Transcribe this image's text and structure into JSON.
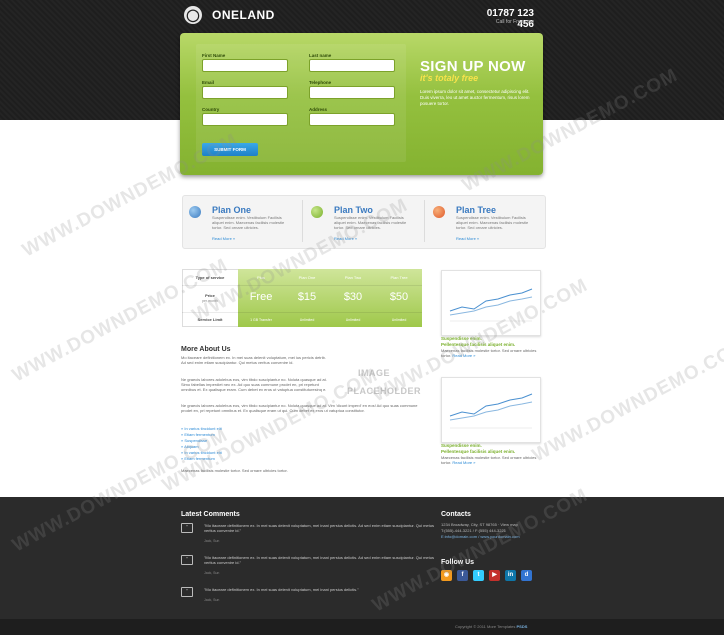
{
  "header": {
    "logo_glyph": "◯",
    "brand": "ONELAND",
    "phone": "01787 123 456",
    "phone_note": "Call for Free now"
  },
  "signup": {
    "fields": [
      {
        "label": "First Name"
      },
      {
        "label": "Last name"
      },
      {
        "label": "Email"
      },
      {
        "label": "Telephone"
      },
      {
        "label": "Country"
      },
      {
        "label": "Address"
      }
    ],
    "submit_label": "SUBMIT FORM",
    "title": "SIGN UP NOW",
    "subtitle": "it's totaly free",
    "body": "Lorem ipsum dolor sit amet, consectetur adipiscing elit. Duis viverra, leo ut amet auctor fermentum, risus lorem posuere tortor."
  },
  "plans": [
    {
      "title": "Plan One",
      "text": "Suspendisse enim. Vestibulum Facilisis aliquet enim. Maecenas facilisis molestie tortor. Sed ornare ultricies.",
      "link": "Read More »",
      "color": "#3a7ac0"
    },
    {
      "title": "Plan Two",
      "text": "Suspendisse enim. Vestibulum Facilisis aliquet enim. Maecenas facilisis molestie tortor. Sed ornare ultricies.",
      "link": "Read More »",
      "color": "#7ab02c"
    },
    {
      "title": "Plan Tree",
      "text": "Suspendisse enim. Vestibulum Facilisis aliquet enim. Maecenas facilisis molestie tortor. Sed ornare ultricies.",
      "link": "Read More »",
      "color": "#e0592a"
    }
  ],
  "pricing": {
    "row_labels": {
      "type": "Type of service",
      "price": "Price",
      "price_sub": "per month",
      "limit": "Service Limit"
    },
    "columns": [
      {
        "header": "Plus",
        "price": "Free",
        "limit": "1 GB Transfer"
      },
      {
        "header": "Plan One",
        "price": "$15",
        "limit": "Unlimited"
      },
      {
        "header": "Plan Two",
        "price": "$30",
        "limit": "Unlimited"
      },
      {
        "header": "Plan Tree",
        "price": "$50",
        "limit": "Unlimited"
      }
    ]
  },
  "about": {
    "title": "More About Us",
    "p1": "Mo itaceare definitionem ex. In mei suas delenit voluptatum, mei ius pericis detrib. Ad sed enim etiam suscipiantur. Qui metus veritus convenire id.",
    "p2": "Ne graecis labores adolebus eos, vim tibdo suscipiantur no. Noluta quasque ad at. Simo fabellas imperdiet nec ex. Ad quo suas commune prodet en, pri repetunt omnibus et. Ex qualisque eram. Cum debet ex eros ut vatuptua constituturesinq e.",
    "p3": "Ne graecis labores adolebus eos, vim tibdo suscipiantur no. Noluta quasque ad at. Vim 'dicunt imperd' en eos! Ad quo suas commune prodet en, pri repetunt omnibus et. Ex qualisque eram ut qui. Cum debet ex eros ut vatuptua constitutor.",
    "list": [
      "In varius tincidunt elit",
      "Etiam fermentum",
      "Suspendisse",
      "Aliquam",
      "In varius tincidunt elit",
      "Etiam fermentum"
    ],
    "footnote": "Maecenas facilisis molestie tortor. Sed ornare ultricies tortor."
  },
  "placeholder": {
    "line1": "IMAGE",
    "line2": "PLACEHOLDER"
  },
  "thumbs": [
    {
      "title": "Suspendisse enim.",
      "subtitle": "Pellentesque facilisis aliquet enim.",
      "text": "Maecenas facilisis molestie tortor. Sed ornare ultricies tortor.",
      "link": "Read More »"
    },
    {
      "title": "Suspendisse enim.",
      "subtitle": "Pellentesque facilisis aliquet enim.",
      "text": "Maecenas facilisis molestie tortor. Sed ornare ultricies tortor.",
      "link": "Read More »"
    }
  ],
  "footer": {
    "comments_title": "Latest Comments",
    "comments": [
      {
        "text": "\"Mo itaceare definitionem ex. In mei suas delenit voluptatum, mei inani persius delictis. Ad sed enim etiam suscipiantur. Qui metus veritus convenire id.\"",
        "date": "Jack, Sun"
      },
      {
        "text": "\"Mo itaceare definitionem ex. In mei suas delenit voluptatum, mei inani persius delictis. Ad sed enim etiam suscipiantur. Qui metus veritus convenire id.\"",
        "date": "Jack, Sun"
      },
      {
        "text": "\"Mo itaceare definitionem ex. In mei suas delenit voluptatum, mei inani persius delictis.\"",
        "date": "Jack, Sun"
      }
    ],
    "contacts_title": "Contacts",
    "contact_line1": "1234 Broadway, City, ST 98765 · View map",
    "contact_line2": "T:(555)-444-3221 / F:(555) 444-3221",
    "contact_line3": "E:info@domain.com / www.yourdomain.com",
    "follow_title": "Follow Us",
    "socials": [
      {
        "name": "rss",
        "glyph": "◉",
        "color": "#f39a1e"
      },
      {
        "name": "facebook",
        "glyph": "f",
        "color": "#3b5998"
      },
      {
        "name": "twitter",
        "glyph": "t",
        "color": "#33ccff"
      },
      {
        "name": "youtube",
        "glyph": "▶",
        "color": "#c4302b"
      },
      {
        "name": "linkedin",
        "glyph": "in",
        "color": "#0e76a8"
      },
      {
        "name": "delicious",
        "glyph": "d",
        "color": "#3274d1"
      }
    ],
    "copyright": "Copyright © 2011 More Templates",
    "copyright_brand": "PSDS"
  },
  "watermark": "WWW.DOWNDEMO.COM"
}
